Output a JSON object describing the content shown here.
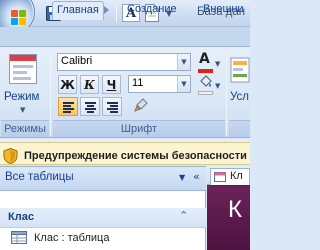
{
  "window": {
    "title": "База дан"
  },
  "quick_access": {
    "font_button_label": "A"
  },
  "ribbon": {
    "tabs": [
      {
        "label": "Главная",
        "active": true
      },
      {
        "label": "Создание",
        "active": false
      },
      {
        "label": "Внешни",
        "active": false
      }
    ],
    "groups": {
      "modes": {
        "caption": "Режимы",
        "view_button_label": "Режим"
      },
      "font": {
        "caption": "Шрифт",
        "font_name": "Calibri",
        "font_size": "11",
        "bold_label": "Ж",
        "italic_label": "К",
        "underline_label": "Ч",
        "font_color_label": "A",
        "font_color": "#e51e1e"
      },
      "next": {
        "label": "Усл"
      }
    }
  },
  "message_bar": {
    "text": "Предупреждение системы безопасности"
  },
  "navigation_pane": {
    "title": "Все таблицы",
    "group": {
      "name": "Клас",
      "items": [
        {
          "label": "Клас : таблица"
        }
      ]
    }
  },
  "document": {
    "tab_label": "Кл",
    "form_title": "К",
    "header_color": "#5a1a4c"
  }
}
